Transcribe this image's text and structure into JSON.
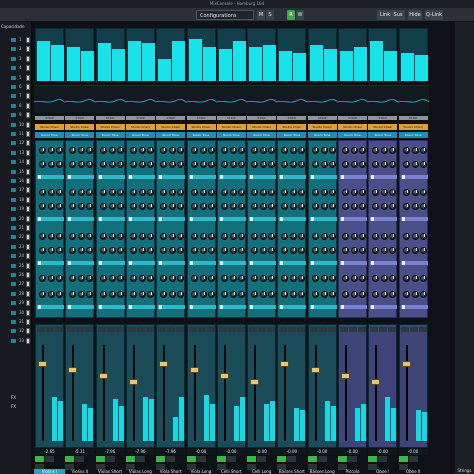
{
  "window": {
    "title": "MixConsole - Hamburg 104"
  },
  "toolbar": {
    "configurations": "Configurations",
    "buttons": [
      "M",
      "S",
      "R",
      "W"
    ],
    "link": "Link",
    "sus": "Sus",
    "hide": "Hide",
    "qlink": "Q-Link"
  },
  "rack": {
    "header": "Capacidade"
  },
  "left_rows": [
    "1",
    "2",
    "3",
    "4",
    "5",
    "6",
    "7",
    "8",
    "9",
    "10",
    "11",
    "12",
    "13",
    "14",
    "15",
    "16",
    "17",
    "18",
    "19",
    "20",
    "21",
    "22",
    "23",
    "24",
    "25",
    "26",
    "27",
    "28",
    "29",
    "30",
    "31",
    "32",
    "33"
  ],
  "left_fx": [
    "FX",
    "FX"
  ],
  "strip_labels": {
    "strip": "STRIP",
    "insert_a": "Studio Chain",
    "insert_b": "Room Tone"
  },
  "strips": [
    {
      "name": "Violins I",
      "value": "-2.65",
      "panel": "teal",
      "meters": [
        40,
        36
      ]
    },
    {
      "name": "Violins II",
      "value": "-5.31",
      "panel": "teal",
      "meters": [
        34,
        30
      ]
    },
    {
      "name": "Violas Short",
      "value": "-7.96",
      "panel": "teal",
      "meters": [
        38,
        32
      ]
    },
    {
      "name": "Violas Long",
      "value": "-7.96",
      "panel": "teal",
      "meters": [
        40,
        38
      ]
    },
    {
      "name": "Viola Short",
      "value": "-7.96",
      "panel": "teal",
      "meters": [
        22,
        40
      ]
    },
    {
      "name": "Viola Long",
      "value": "-0.00",
      "panel": "teal",
      "meters": [
        42,
        34
      ]
    },
    {
      "name": "Celli Short",
      "value": "-0.00",
      "panel": "teal",
      "meters": [
        32,
        40
      ]
    },
    {
      "name": "Celli Long",
      "value": "-0.00",
      "panel": "teal",
      "meters": [
        34,
        36
      ]
    },
    {
      "name": "Basses Short",
      "value": "-0.00",
      "panel": "teal",
      "meters": [
        30,
        28
      ]
    },
    {
      "name": "Basses Long",
      "value": "-0.00",
      "panel": "teal",
      "meters": [
        36,
        32
      ]
    },
    {
      "name": "Piccolo",
      "value": "-0.00",
      "panel": "purple",
      "meters": [
        30,
        34
      ]
    },
    {
      "name": "Oboe I",
      "value": "-0.00",
      "panel": "purple",
      "meters": [
        40,
        30
      ]
    },
    {
      "name": "Oboe II",
      "value": "-0.00",
      "panel": "purple",
      "meters": [
        28,
        26
      ]
    }
  ],
  "right_panel": {
    "label": "Strings"
  },
  "colors": {
    "accent": "#19e3ea",
    "teal_panel": "#12707d",
    "purple_panel": "#4a4f8a",
    "insert": "#d8a13a"
  }
}
